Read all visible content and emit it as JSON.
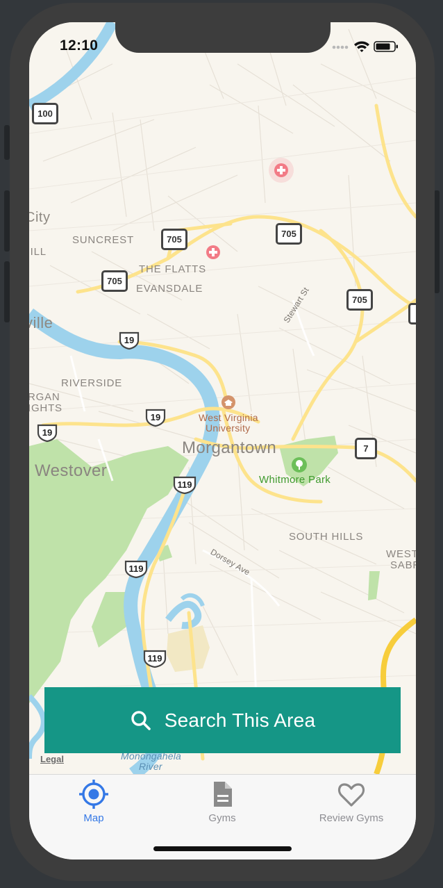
{
  "status_bar": {
    "time": "12:10"
  },
  "map": {
    "labels": {
      "city_partial": "City",
      "suncrest": "SUNCREST",
      "hill_partial": "HILL",
      "the_flatts": "THE FLATTS",
      "evansdale": "EVANSDALE",
      "ville_partial": "ville",
      "riverside": "RIVERSIDE",
      "morgan_partial_1": "RGAN",
      "morgan_partial_2": "IGHTS",
      "west_virginia_university_1": "West Virginia",
      "west_virginia_university_2": "University",
      "morgantown": "Morgantown",
      "westover": "Westover",
      "whitmore_park": "Whitmore Park",
      "south_hills": "SOUTH HILLS",
      "west_sabraton_1": "WEST",
      "west_sabraton_2": "SABRAT",
      "stewart_st": "Stewart St",
      "dorsey_ave": "Dorsey Ave",
      "monongahela_1": "Monongahela",
      "monongahela_2": "River"
    },
    "route_shields": {
      "r100": "100",
      "r705_a": "705",
      "r705_b": "705",
      "r705_c": "705",
      "r705_d": "705",
      "r7": "7",
      "us19_a": "19",
      "us19_b": "19",
      "us19_c": "19",
      "us119_a": "119",
      "us119_b": "119",
      "us119_c": "119"
    },
    "legal_link": "Legal",
    "colors": {
      "land": "#f8f5ee",
      "water": "#9dd2ec",
      "park": "#bfe2a9",
      "road_major": "#fde38c",
      "accent": "#159686"
    }
  },
  "search_button": {
    "label": "Search This Area"
  },
  "tab_bar": {
    "tabs": [
      {
        "label": "Map",
        "icon": "crosshair-icon",
        "active": true
      },
      {
        "label": "Gyms",
        "icon": "document-icon",
        "active": false
      },
      {
        "label": "Review Gyms",
        "icon": "heart-icon",
        "active": false
      }
    ]
  }
}
